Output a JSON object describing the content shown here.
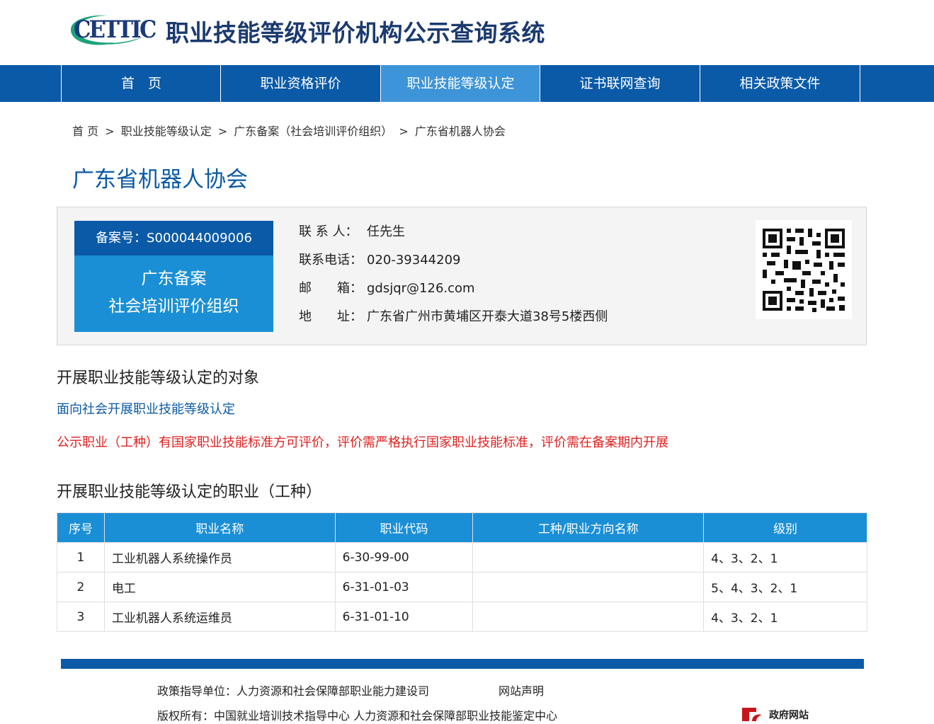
{
  "header": {
    "logo_text": "CETTIC",
    "site_title": "职业技能等级评价机构公示查询系统"
  },
  "nav": {
    "items": [
      {
        "label": "首　页"
      },
      {
        "label": "职业资格评价"
      },
      {
        "label": "职业技能等级认定"
      },
      {
        "label": "证书联网查询"
      },
      {
        "label": "相关政策文件"
      }
    ],
    "active_index": 2
  },
  "breadcrumb": {
    "items": [
      "首 页",
      ">",
      "职业技能等级认定",
      ">",
      "广东备案（社会培训评价组织）",
      ">",
      "广东省机器人协会"
    ]
  },
  "org": {
    "title": "广东省机器人协会",
    "record_no": "备案号：S000044009006",
    "badge_line1": "广东备案",
    "badge_line2": "社会培训评价组织",
    "contact_label": "联 系 人：",
    "contact_value": "任先生",
    "phone_label": "联系电话：",
    "phone_value": "020-39344209",
    "email_label": "邮　　箱：",
    "email_value": "gdsjqr@126.com",
    "address_label": "地　　址：",
    "address_value": "广东省广州市黄埔区开泰大道38号5楼西侧"
  },
  "sections": {
    "target_title": "开展职业技能等级认定的对象",
    "target_value": "面向社会开展职业技能等级认定",
    "notice": "公示职业（工种）有国家职业技能标准方可评价，评价需严格执行国家职业技能标准，评价需在备案期内开展",
    "occupation_title": "开展职业技能等级认定的职业（工种）"
  },
  "table": {
    "headers": [
      "序号",
      "职业名称",
      "职业代码",
      "工种/职业方向名称",
      "级别"
    ],
    "rows": [
      [
        "1",
        "工业机器人系统操作员",
        "6-30-99-00",
        "",
        "4、3、2、1"
      ],
      [
        "2",
        "电工",
        "6-31-01-03",
        "",
        "5、4、3、2、1"
      ],
      [
        "3",
        "工业机器人系统运维员",
        "6-31-01-10",
        "",
        "4、3、2、1"
      ]
    ]
  },
  "footer": {
    "guide": "政策指导单位：人力资源和社会保障部职业能力建设司",
    "statement": "网站声明",
    "copyright": "版权所有：中国就业培训技术指导中心  人力资源和社会保障部职业技能鉴定中心",
    "gov_label": "政府网站"
  },
  "colors": {
    "brand_blue": "#0a5aa8",
    "accent_blue": "#1a8fd6",
    "nav_active": "#3d94d8",
    "notice_red": "#e02020"
  }
}
